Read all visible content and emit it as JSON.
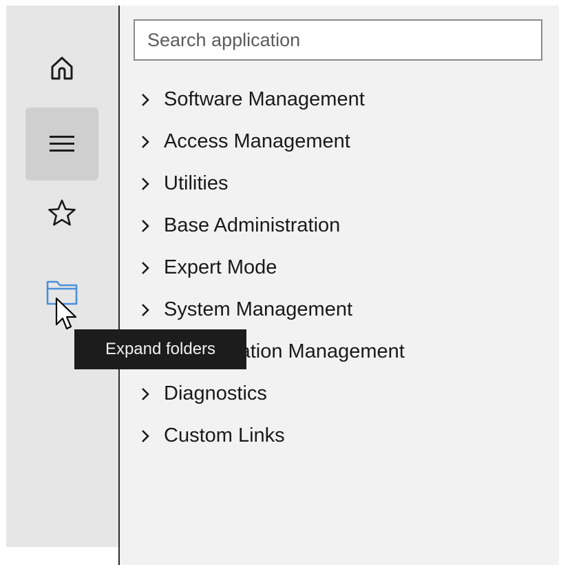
{
  "rail": {
    "items": [
      {
        "name": "home",
        "icon": "home-icon"
      },
      {
        "name": "menu",
        "icon": "hamburger-menu-icon",
        "active": true
      },
      {
        "name": "favorites",
        "icon": "star-icon"
      },
      {
        "name": "expand-folders",
        "icon": "folder-icon"
      }
    ],
    "accent": "#4a90d9"
  },
  "search": {
    "placeholder": "Search application",
    "value": ""
  },
  "tree": {
    "items": [
      {
        "label": "Software Management"
      },
      {
        "label": "Access Management"
      },
      {
        "label": "Utilities"
      },
      {
        "label": "Base Administration"
      },
      {
        "label": "Expert Mode"
      },
      {
        "label": "System Management"
      },
      {
        "label": "Configuration Management"
      },
      {
        "label": "Diagnostics"
      },
      {
        "label": "Custom Links"
      }
    ]
  },
  "tooltip": {
    "text": "Expand folders"
  }
}
